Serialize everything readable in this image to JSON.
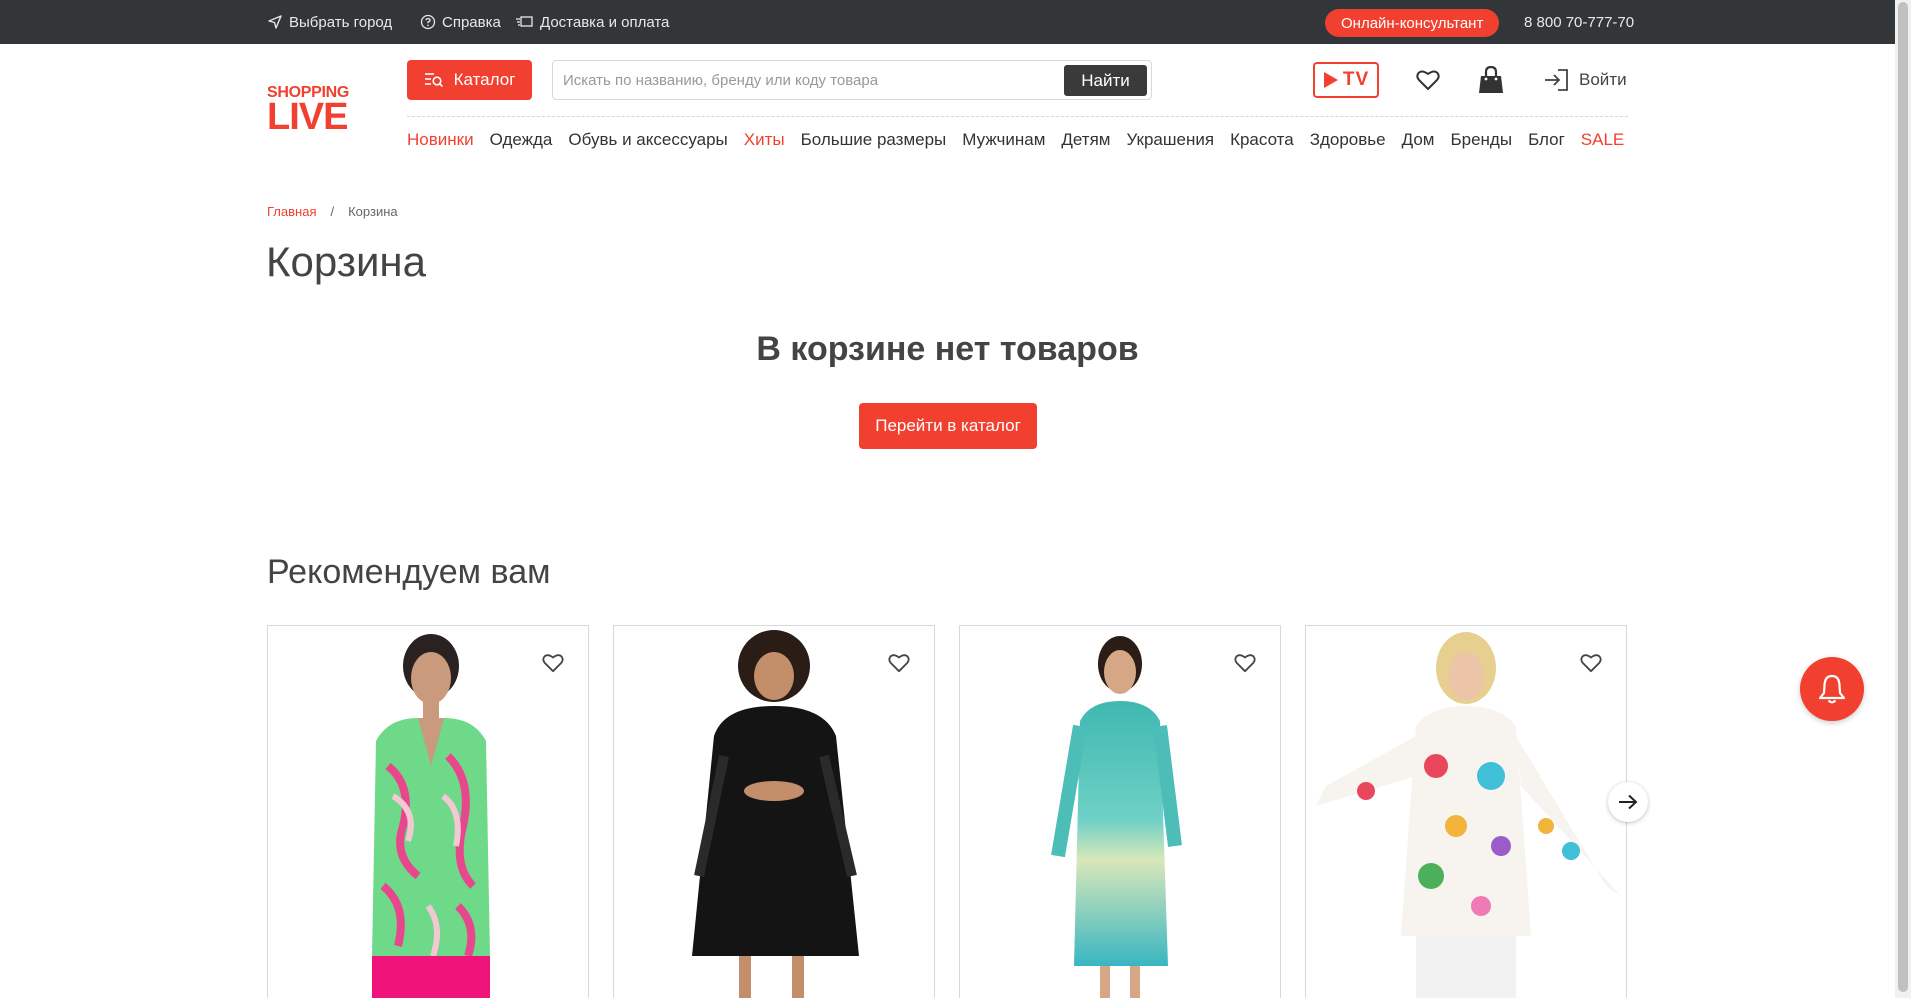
{
  "colors": {
    "accent": "#f1402f",
    "topbar": "#333639",
    "dark_button": "#3a3a3a"
  },
  "topbar": {
    "city": "Выбрать город",
    "help": "Справка",
    "delivery": "Доставка и оплата",
    "consultant": "Онлайн-консультант",
    "phone": "8 800 70-777-70"
  },
  "logo": {
    "line1": "SHOPPING",
    "line2": "LIVE"
  },
  "header": {
    "catalog_label": "Каталог",
    "search_placeholder": "Искать по названию, бренду или коду товара",
    "search_value": "",
    "find_label": "Найти",
    "tv_label": "TV",
    "login_label": "Войти"
  },
  "nav": [
    {
      "label": "Новинки",
      "highlight": true
    },
    {
      "label": "Одежда",
      "highlight": false
    },
    {
      "label": "Обувь и аксессуары",
      "highlight": false
    },
    {
      "label": "Хиты",
      "highlight": true
    },
    {
      "label": "Большие размеры",
      "highlight": false
    },
    {
      "label": "Мужчинам",
      "highlight": false
    },
    {
      "label": "Детям",
      "highlight": false
    },
    {
      "label": "Украшения",
      "highlight": false
    },
    {
      "label": "Красота",
      "highlight": false
    },
    {
      "label": "Здоровье",
      "highlight": false
    },
    {
      "label": "Дом",
      "highlight": false
    },
    {
      "label": "Бренды",
      "highlight": false
    },
    {
      "label": "Блог",
      "highlight": false
    },
    {
      "label": "SALE",
      "highlight": true
    }
  ],
  "breadcrumb": {
    "home": "Главная",
    "separator": "/",
    "current": "Корзина"
  },
  "page_title": "Корзина",
  "cart": {
    "empty_message": "В корзине нет товаров",
    "goto_catalog": "Перейти в каталог"
  },
  "recommendations": {
    "title": "Рекомендуем вам",
    "products": [
      {
        "image": "woman-in-green-pink-print-blouse"
      },
      {
        "image": "woman-in-black-lace-dress"
      },
      {
        "image": "woman-in-turquoise-shirt-dress"
      },
      {
        "image": "woman-in-floral-print-blouse"
      }
    ]
  },
  "icons": {
    "city": "location-arrow-icon",
    "help": "question-circle-icon",
    "delivery": "truck-icon",
    "catalog": "catalog-search-icon",
    "favorites": "heart-icon",
    "cart": "shopping-bag-icon",
    "login": "login-icon",
    "next": "arrow-right-icon",
    "notifications": "bell-icon"
  }
}
